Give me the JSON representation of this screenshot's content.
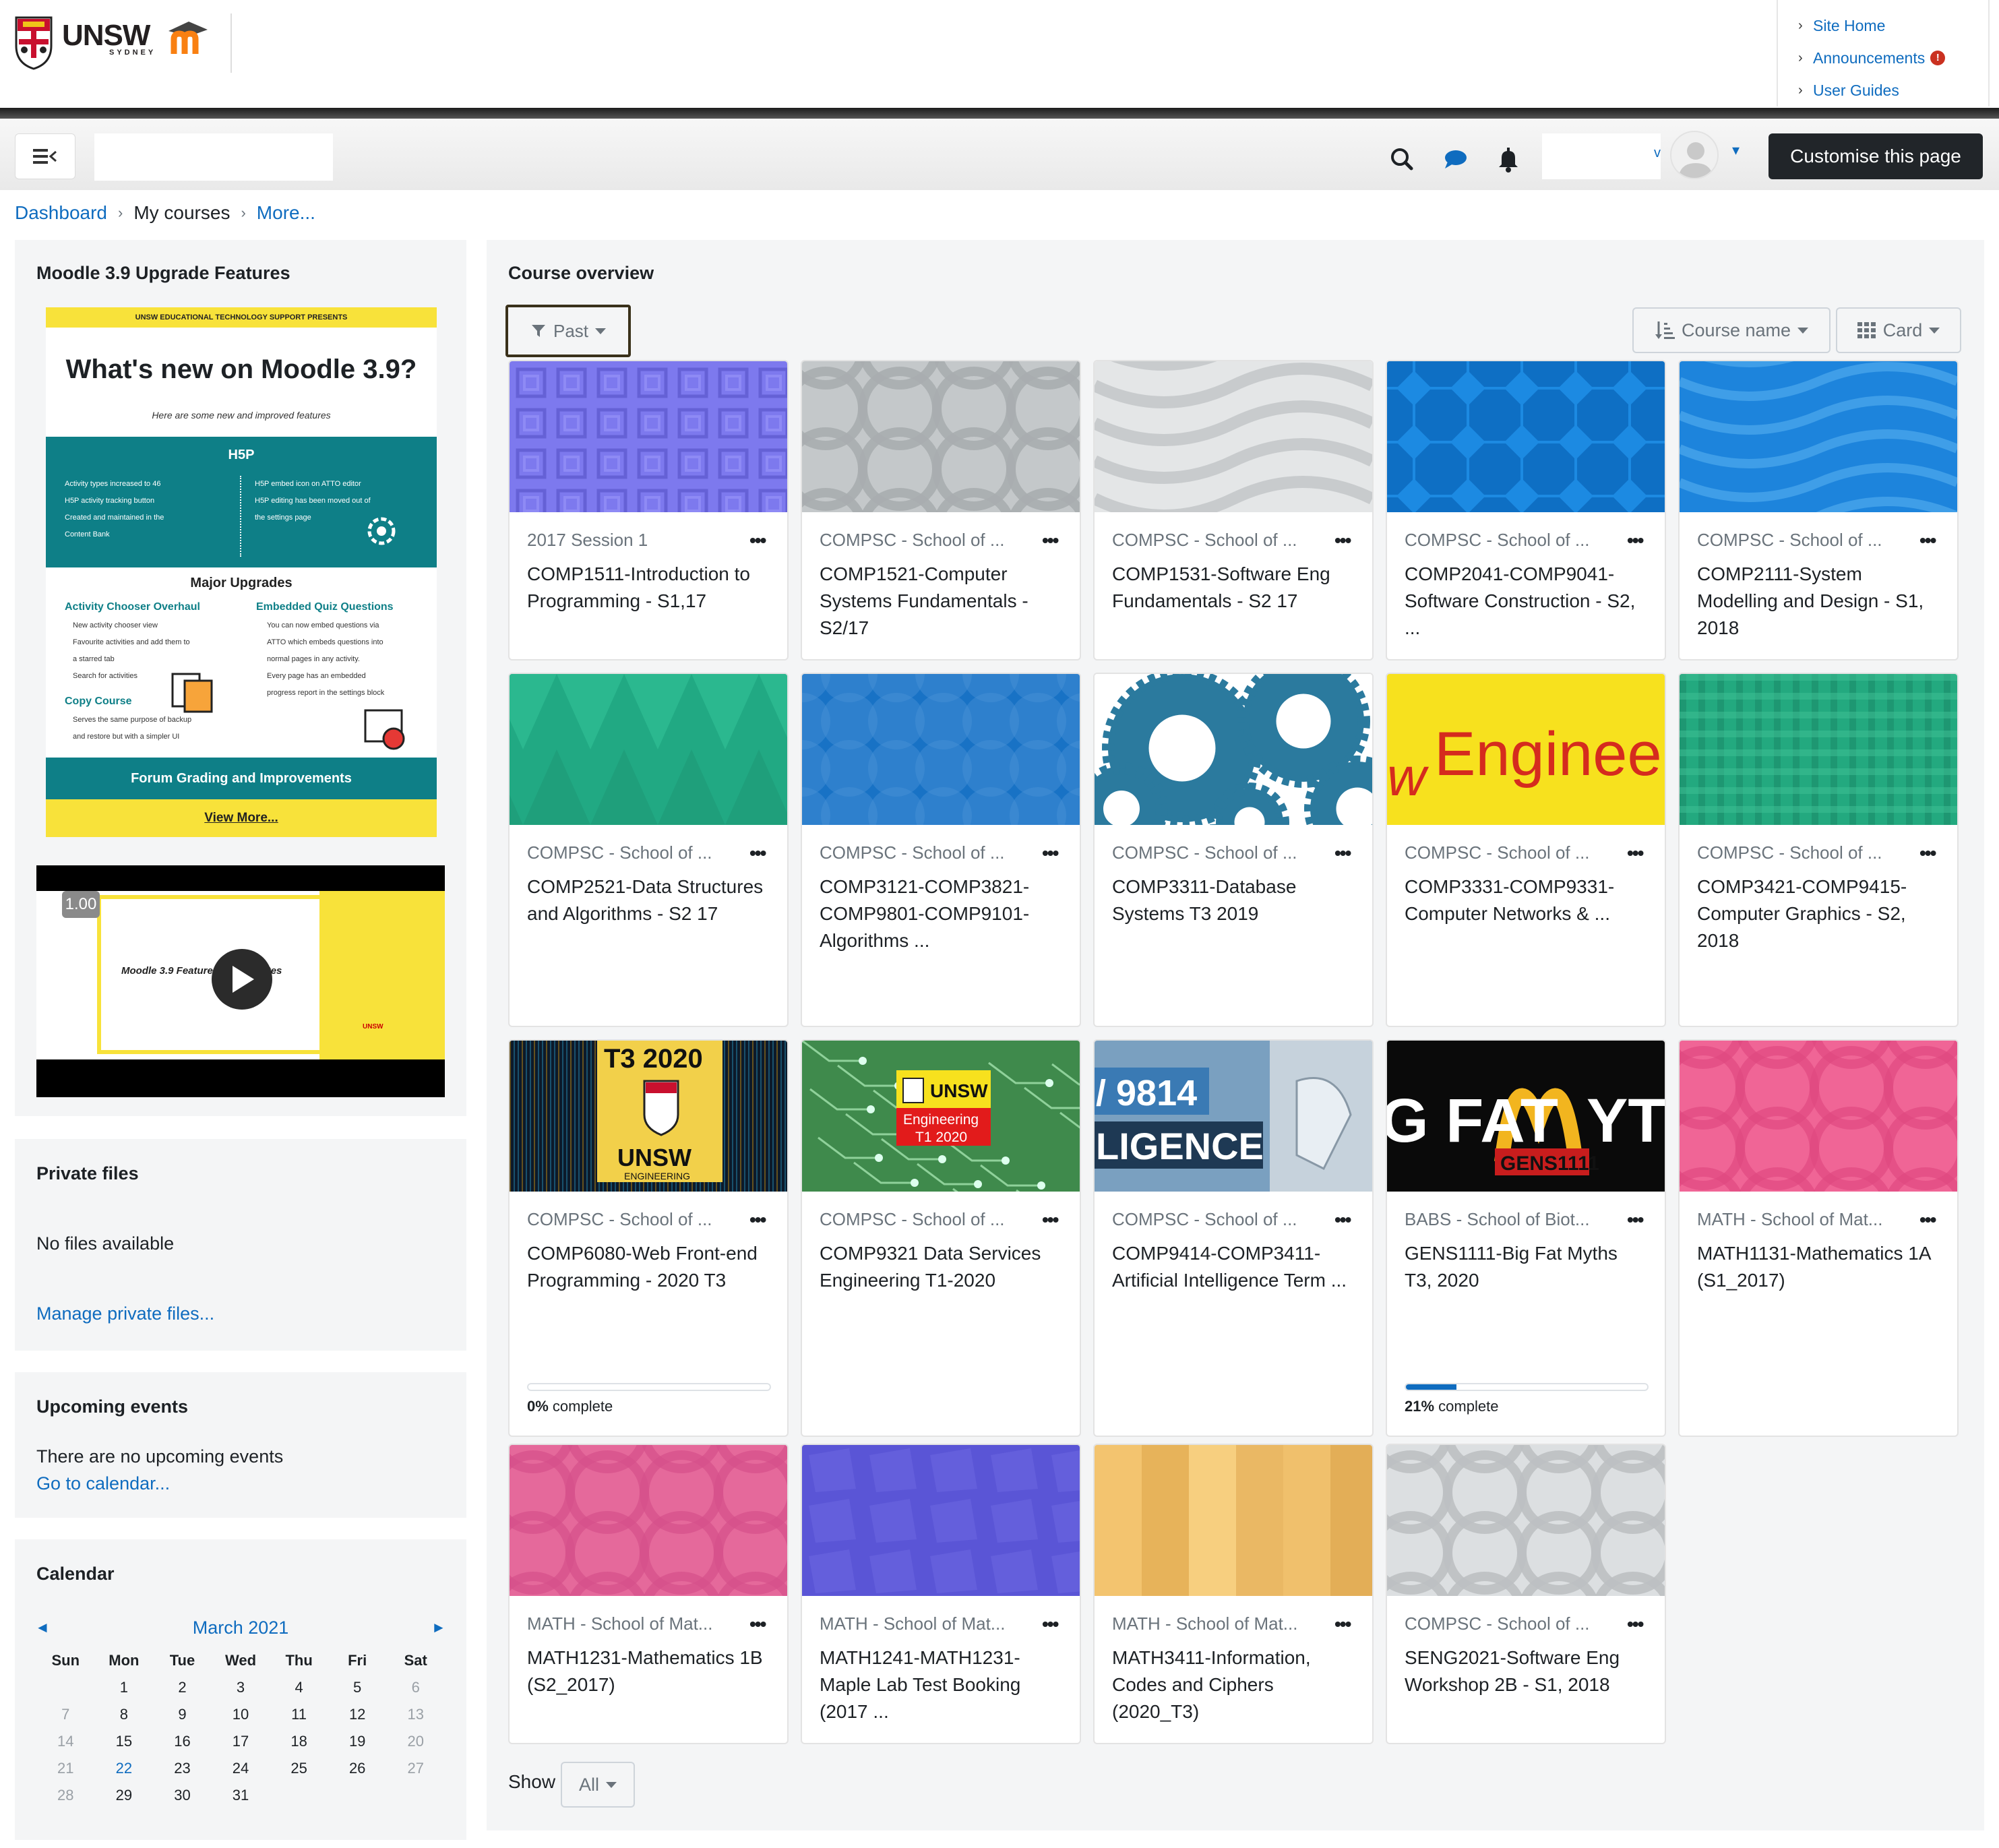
{
  "header": {
    "brand": "UNSW",
    "brand_sub": "SYDNEY",
    "top_links": [
      {
        "label": "Site Home"
      },
      {
        "label": "Announcements",
        "alert": true
      },
      {
        "label": "User Guides"
      }
    ],
    "customise_label": "Customise this page",
    "user_caret": "v"
  },
  "breadcrumb": [
    "Dashboard",
    "My courses",
    "More..."
  ],
  "upgrade_block": {
    "title": "Moodle 3.9 Upgrade Features",
    "poster": {
      "banner": "UNSW EDUCATIONAL TECHNOLOGY SUPPORT PRESENTS",
      "headline": "What's new on Moodle 3.9?",
      "subline": "Here are some new and improved features",
      "h5p_title": "H5P",
      "h5p_left": [
        "Activity types increased to 46",
        "H5P activity tracking button",
        "Created and maintained in the",
        "Content Bank"
      ],
      "h5p_right": [
        "H5P embed icon on ATTO editor",
        "H5P editing has been moved out of",
        "the settings page"
      ],
      "major": "Major Upgrades",
      "activity_title": "Activity Chooser Overhaul",
      "activity_items": [
        "New activity chooser view",
        "Favourite activities and add them to",
        "a starred tab",
        "Search for activities"
      ],
      "copy_title": "Copy Course",
      "copy_items": [
        "Serves the same purpose of backup",
        "and restore but with a simpler UI"
      ],
      "quiz_title": "Embedded Quiz Questions",
      "quiz_items": [
        "You can now embed questions via",
        "ATTO which embeds questions into",
        "normal pages in any activity.",
        "Every page has an embedded",
        "progress report in the settings block"
      ],
      "forum_bar": "Forum Grading and Improvements",
      "view_more": "View More..."
    },
    "video": {
      "speed": "1.00",
      "title": "Moodle 3.9 Features and Updates",
      "mini_brand": "UNSW"
    }
  },
  "private_files": {
    "title": "Private files",
    "empty": "No files available",
    "manage_link": "Manage private files..."
  },
  "upcoming_events": {
    "title": "Upcoming events",
    "empty": "There are no upcoming events",
    "calendar_link": "Go to calendar..."
  },
  "calendar": {
    "title": "Calendar",
    "month": "March 2021",
    "prev": "◄",
    "next": "►",
    "weekdays": [
      "Sun",
      "Mon",
      "Tue",
      "Wed",
      "Thu",
      "Fri",
      "Sat"
    ],
    "weeks": [
      [
        "",
        "1",
        "2",
        "3",
        "4",
        "5",
        "6"
      ],
      [
        "7",
        "8",
        "9",
        "10",
        "11",
        "12",
        "13"
      ],
      [
        "14",
        "15",
        "16",
        "17",
        "18",
        "19",
        "20"
      ],
      [
        "21",
        "22",
        "23",
        "24",
        "25",
        "26",
        "27"
      ],
      [
        "28",
        "29",
        "30",
        "31",
        "",
        "",
        ""
      ]
    ],
    "today": "22"
  },
  "course_overview": {
    "title": "Course overview",
    "filter_label": "Past",
    "sort_label": "Course name",
    "view_label": "Card",
    "show_label": "Show",
    "show_value": "All",
    "complete_suffix": " complete",
    "courses": [
      {
        "category": "2017 Session 1",
        "name": "COMP1511-Introduction to Programming - S1,17",
        "thumb": "purple-squares"
      },
      {
        "category": "COMPSC - School of ...",
        "name": "COMP1521-Computer Systems Fundamentals - S2/17",
        "thumb": "grey-circles"
      },
      {
        "category": "COMPSC - School of ...",
        "name": "COMP1531-Software Eng Fundamentals - S2 17",
        "thumb": "light-waves"
      },
      {
        "category": "COMPSC - School of ...",
        "name": "COMP2041-COMP9041-Software Construction - S2, ...",
        "thumb": "blue-octagons"
      },
      {
        "category": "COMPSC - School of ...",
        "name": "COMP2111-System Modelling and Design - S1, 2018",
        "thumb": "blue-waves"
      },
      {
        "category": "COMPSC - School of ...",
        "name": "COMP2521-Data Structures and Algorithms - S2 17",
        "thumb": "green-triangles"
      },
      {
        "category": "COMPSC - School of ...",
        "name": "COMP3121-COMP3821-COMP9801-COMP9101-Algorithms ...",
        "thumb": "blue-circles"
      },
      {
        "category": "COMPSC - School of ...",
        "name": "COMP3311-Database Systems T3 2019",
        "thumb": "gears"
      },
      {
        "category": "COMPSC - School of ...",
        "name": "COMP3331-COMP9331-Computer Networks & ...",
        "thumb": "engineering-text",
        "thumb_text": "Enginee",
        "thumb_text2": "w"
      },
      {
        "category": "COMPSC - School of ...",
        "name": "COMP3421-COMP9415-Computer Graphics - S2, 2018",
        "thumb": "green-plaid"
      },
      {
        "category": "COMPSC - School of ...",
        "name": "COMP6080-Web Front-end Programming - 2020 T3",
        "thumb": "t3-2020",
        "thumb_text": "T3 2020",
        "thumb_text2": "UNSW",
        "thumb_text3": "ENGINEERING",
        "progress": 0,
        "progress_label": "0%"
      },
      {
        "category": "COMPSC - School of ...",
        "name": "COMP9321 Data Services Engineering T1-2020",
        "thumb": "circuit",
        "thumb_text": "UNSW",
        "thumb_text2": "Engineering",
        "thumb_text3": "T1 2020"
      },
      {
        "category": "COMPSC - School of ...",
        "name": "COMP9414-COMP3411-Artificial Intelligence Term ...",
        "thumb": "ai-robot",
        "thumb_text": "/ 9814",
        "thumb_text2": "LIGENCE"
      },
      {
        "category": "BABS - School of Biot...",
        "name": "GENS1111-Big Fat Myths T3, 2020",
        "thumb": "fat-myths",
        "thumb_text": "G FAT",
        "thumb_text2": "YT",
        "thumb_text3": "GENS1111",
        "progress": 0.21,
        "progress_label": "21%"
      },
      {
        "category": "MATH - School of Mat...",
        "name": "MATH1131-Mathematics 1A (S1_2017)",
        "thumb": "pink-circles"
      },
      {
        "category": "MATH - School of Mat...",
        "name": "MATH1231-Mathematics 1B (S2_2017)",
        "thumb": "pink-circles-2"
      },
      {
        "category": "MATH - School of Mat...",
        "name": "MATH1241-MATH1231-Maple Lab Test Booking (2017 ...",
        "thumb": "indigo-poly"
      },
      {
        "category": "MATH - School of Mat...",
        "name": "MATH3411-Information, Codes and Ciphers (2020_T3)",
        "thumb": "orange-tiles"
      },
      {
        "category": "COMPSC - School of ...",
        "name": "SENG2021-Software Eng Workshop 2B - S1, 2018",
        "thumb": "grey-circles-2"
      }
    ]
  },
  "colors": {
    "link": "#0f6cbf",
    "dark_button": "#212529",
    "block_bg": "#f4f5f6",
    "poster_teal": "#0e7f87",
    "poster_yellow": "#f8e23a"
  }
}
